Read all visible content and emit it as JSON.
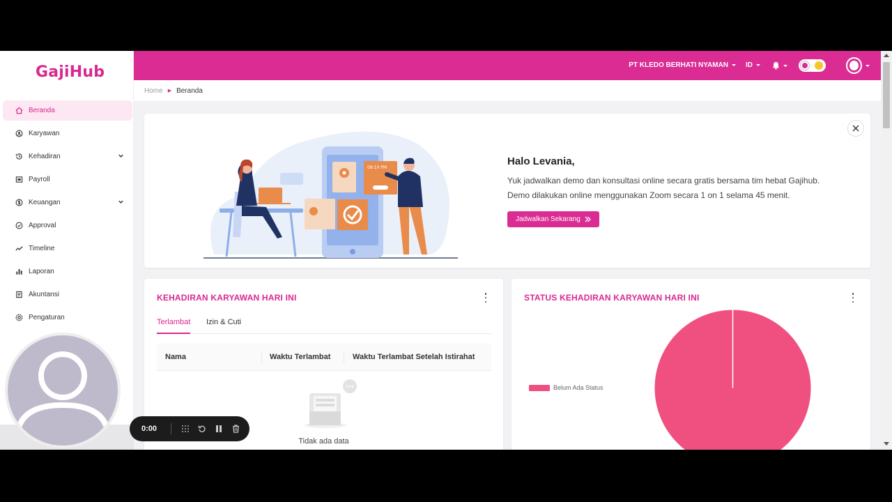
{
  "brand": {
    "logo_text": "GajiHub",
    "accent": "#da2c93",
    "pie_color": "#f0507f"
  },
  "sidebar": {
    "items": [
      {
        "label": "Beranda",
        "icon": "home-icon",
        "active": true
      },
      {
        "label": "Karyawan",
        "icon": "users-icon"
      },
      {
        "label": "Kehadiran",
        "icon": "history-icon",
        "expandable": true
      },
      {
        "label": "Payroll",
        "icon": "wallet-icon"
      },
      {
        "label": "Keuangan",
        "icon": "dollar-circle-icon",
        "expandable": true
      },
      {
        "label": "Approval",
        "icon": "check-circle-icon"
      },
      {
        "label": "Timeline",
        "icon": "line-chart-icon"
      },
      {
        "label": "Laporan",
        "icon": "bar-chart-icon"
      },
      {
        "label": "Akuntansi",
        "icon": "book-icon"
      },
      {
        "label": "Pengaturan",
        "icon": "gear-icon"
      }
    ]
  },
  "topbar": {
    "company": "PT KLEDO BERHATI NYAMAN",
    "language": "ID"
  },
  "breadcrumb": {
    "home": "Home",
    "current": "Beranda"
  },
  "banner": {
    "greeting": "Halo Levania,",
    "line1": "Yuk jadwalkan demo dan konsultasi online secara gratis bersama tim hebat Gajihub.",
    "line2": "Demo dilakukan online menggunakan Zoom secara 1 on 1 selama 45 menit.",
    "button": "Jadwalkan Sekarang",
    "illus_time": "09:10 PM"
  },
  "attendance_card": {
    "title": "KEHADIRAN KARYAWAN HARI INI",
    "tabs": [
      "Terlambat",
      "Izin & Cuti"
    ],
    "columns": [
      "Nama",
      "Waktu Terlambat",
      "Waktu Terlambat Setelah Istirahat"
    ],
    "empty": "Tidak ada data"
  },
  "status_card": {
    "title": "STATUS KEHADIRAN KARYAWAN HARI INI",
    "legend": [
      "Belum Ada Status"
    ]
  },
  "chart_data": {
    "type": "pie",
    "categories": [
      "Belum Ada Status"
    ],
    "values": [
      100
    ],
    "legend_position": "left"
  },
  "recorder": {
    "time": "0:00"
  }
}
